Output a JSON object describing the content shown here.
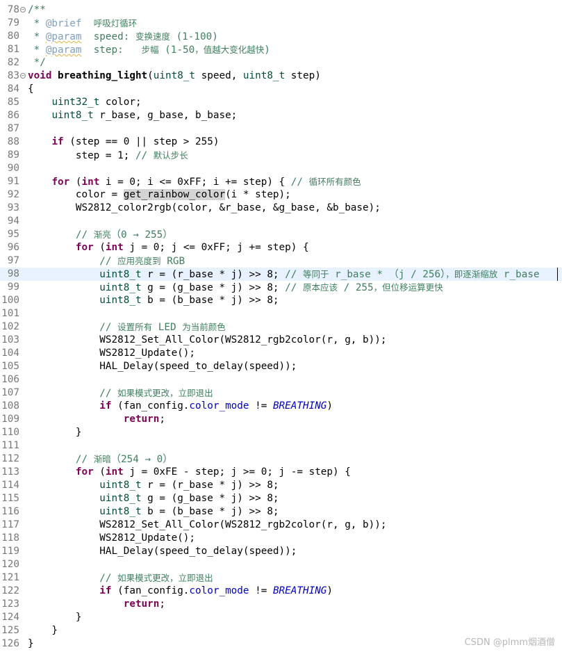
{
  "editor": {
    "first_line": 78,
    "current_line": 98,
    "lines": [
      {
        "n": "78",
        "fold": "−",
        "tokens": [
          [
            "c",
            "/**"
          ]
        ]
      },
      {
        "n": "79",
        "tokens": [
          [
            "c",
            " * "
          ],
          [
            "d",
            "@brief"
          ],
          [
            "c",
            "  "
          ],
          [
            "c cj",
            "呼吸灯循环"
          ]
        ]
      },
      {
        "n": "80",
        "tokens": [
          [
            "c",
            " * "
          ],
          [
            "d sq",
            "@param"
          ],
          [
            "c",
            "  speed: "
          ],
          [
            "c cj",
            "变换速度"
          ],
          [
            "c",
            " (1-100)"
          ]
        ]
      },
      {
        "n": "81",
        "tokens": [
          [
            "c",
            " * "
          ],
          [
            "d sq",
            "@param"
          ],
          [
            "c",
            "  step:   "
          ],
          [
            "c cj",
            "步幅"
          ],
          [
            "c",
            " (1-50"
          ],
          [
            "c cj",
            "，值越大变化越快"
          ],
          [
            "c",
            ")"
          ]
        ]
      },
      {
        "n": "82",
        "tokens": [
          [
            "c",
            " */"
          ]
        ]
      },
      {
        "n": "83",
        "fold": "−",
        "tokens": [
          [
            "k",
            "void"
          ],
          [
            "",
            " "
          ],
          [
            "b",
            "breathing_light"
          ],
          [
            "",
            "("
          ],
          [
            "t",
            "uint8_t"
          ],
          [
            "",
            " speed, "
          ],
          [
            "t",
            "uint8_t"
          ],
          [
            "",
            " step)"
          ]
        ]
      },
      {
        "n": "84",
        "tokens": [
          [
            "",
            "{"
          ]
        ]
      },
      {
        "n": "85",
        "tokens": [
          [
            "",
            "    "
          ],
          [
            "t",
            "uint32_t"
          ],
          [
            "",
            " color;"
          ]
        ]
      },
      {
        "n": "86",
        "tokens": [
          [
            "",
            "    "
          ],
          [
            "t",
            "uint8_t"
          ],
          [
            "",
            " r_base, g_base, b_base;"
          ]
        ]
      },
      {
        "n": "87",
        "tokens": []
      },
      {
        "n": "88",
        "tokens": [
          [
            "",
            "    "
          ],
          [
            "k",
            "if"
          ],
          [
            "",
            " (step == 0 || step > 255)"
          ]
        ]
      },
      {
        "n": "89",
        "tokens": [
          [
            "",
            "        step = 1; "
          ],
          [
            "c",
            "// "
          ],
          [
            "c cj",
            "默认步长"
          ]
        ]
      },
      {
        "n": "90",
        "tokens": []
      },
      {
        "n": "91",
        "tokens": [
          [
            "",
            "    "
          ],
          [
            "k",
            "for"
          ],
          [
            "",
            " ("
          ],
          [
            "k",
            "int"
          ],
          [
            "",
            " i = 0; i <= 0xFF; i += step) { "
          ],
          [
            "c",
            "// "
          ],
          [
            "c cj",
            "循环所有颜色"
          ]
        ]
      },
      {
        "n": "92",
        "tokens": [
          [
            "",
            "        color = "
          ],
          [
            "hl",
            "get_rainbow_color"
          ],
          [
            "",
            "(i * step);"
          ]
        ]
      },
      {
        "n": "93",
        "tokens": [
          [
            "",
            "        WS2812_color2rgb(color, &r_base, &g_base, &b_base);"
          ]
        ]
      },
      {
        "n": "94",
        "tokens": []
      },
      {
        "n": "95",
        "tokens": [
          [
            "",
            "        "
          ],
          [
            "c",
            "// "
          ],
          [
            "c cj",
            "渐亮"
          ],
          [
            "c",
            "（0 → 255）"
          ]
        ]
      },
      {
        "n": "96",
        "tokens": [
          [
            "",
            "        "
          ],
          [
            "k",
            "for"
          ],
          [
            "",
            " ("
          ],
          [
            "k",
            "int"
          ],
          [
            "",
            " j = 0; j <= 0xFF; j += step) {"
          ]
        ]
      },
      {
        "n": "97",
        "tokens": [
          [
            "",
            "            "
          ],
          [
            "c",
            "// "
          ],
          [
            "c cj",
            "应用亮度到"
          ],
          [
            "c",
            " RGB"
          ]
        ]
      },
      {
        "n": "98",
        "tokens": [
          [
            "",
            "            "
          ],
          [
            "t",
            "uint8_t"
          ],
          [
            "",
            " r = (r_base * j) >> 8; "
          ],
          [
            "c",
            "// "
          ],
          [
            "c cj",
            "等同于"
          ],
          [
            "c",
            " r_base * （j / 256）"
          ],
          [
            "c cj",
            "，即逐渐缩放"
          ],
          [
            "c",
            " r_base"
          ]
        ]
      },
      {
        "n": "99",
        "tokens": [
          [
            "",
            "            "
          ],
          [
            "t",
            "uint8_t"
          ],
          [
            "",
            " g = (g_base * j) >> 8; "
          ],
          [
            "c",
            "// "
          ],
          [
            "c cj",
            "原本应该"
          ],
          [
            "c",
            " / 255"
          ],
          [
            "c cj",
            "，但位移运算更快"
          ]
        ]
      },
      {
        "n": "100",
        "tokens": [
          [
            "",
            "            "
          ],
          [
            "t",
            "uint8_t"
          ],
          [
            "",
            " b = (b_base * j) >> 8;"
          ]
        ]
      },
      {
        "n": "101",
        "tokens": []
      },
      {
        "n": "102",
        "tokens": [
          [
            "",
            "            "
          ],
          [
            "c",
            "// "
          ],
          [
            "c cj",
            "设置所有"
          ],
          [
            "c",
            " LED "
          ],
          [
            "c cj",
            "为当前颜色"
          ]
        ]
      },
      {
        "n": "103",
        "tokens": [
          [
            "",
            "            WS2812_Set_All_Color(WS2812_rgb2color(r, g, b));"
          ]
        ]
      },
      {
        "n": "104",
        "tokens": [
          [
            "",
            "            WS2812_Update();"
          ]
        ]
      },
      {
        "n": "105",
        "tokens": [
          [
            "",
            "            HAL_Delay(speed_to_delay(speed));"
          ]
        ]
      },
      {
        "n": "106",
        "tokens": []
      },
      {
        "n": "107",
        "tokens": [
          [
            "",
            "            "
          ],
          [
            "c",
            "// "
          ],
          [
            "c cj",
            "如果模式更改，立即退出"
          ]
        ]
      },
      {
        "n": "108",
        "tokens": [
          [
            "",
            "            "
          ],
          [
            "k",
            "if"
          ],
          [
            "",
            " (fan_config."
          ],
          [
            "f",
            "color_mode"
          ],
          [
            "",
            " != "
          ],
          [
            "e",
            "BREATHING"
          ],
          [
            "",
            ")"
          ]
        ]
      },
      {
        "n": "109",
        "tokens": [
          [
            "",
            "                "
          ],
          [
            "k",
            "return"
          ],
          [
            "",
            ";"
          ]
        ]
      },
      {
        "n": "110",
        "tokens": [
          [
            "",
            "        }"
          ]
        ]
      },
      {
        "n": "111",
        "tokens": []
      },
      {
        "n": "112",
        "tokens": [
          [
            "",
            "        "
          ],
          [
            "c",
            "// "
          ],
          [
            "c cj",
            "渐暗"
          ],
          [
            "c",
            "（254 → 0）"
          ]
        ]
      },
      {
        "n": "113",
        "tokens": [
          [
            "",
            "        "
          ],
          [
            "k",
            "for"
          ],
          [
            "",
            " ("
          ],
          [
            "k",
            "int"
          ],
          [
            "",
            " j = 0xFE - step; j >= 0; j -= step) {"
          ]
        ]
      },
      {
        "n": "114",
        "tokens": [
          [
            "",
            "            "
          ],
          [
            "t",
            "uint8_t"
          ],
          [
            "",
            " r = (r_base * j) >> 8;"
          ]
        ]
      },
      {
        "n": "115",
        "tokens": [
          [
            "",
            "            "
          ],
          [
            "t",
            "uint8_t"
          ],
          [
            "",
            " g = (g_base * j) >> 8;"
          ]
        ]
      },
      {
        "n": "116",
        "tokens": [
          [
            "",
            "            "
          ],
          [
            "t",
            "uint8_t"
          ],
          [
            "",
            " b = (b_base * j) >> 8;"
          ]
        ]
      },
      {
        "n": "117",
        "tokens": [
          [
            "",
            "            WS2812_Set_All_Color(WS2812_rgb2color(r, g, b));"
          ]
        ]
      },
      {
        "n": "118",
        "tokens": [
          [
            "",
            "            WS2812_Update();"
          ]
        ]
      },
      {
        "n": "119",
        "tokens": [
          [
            "",
            "            HAL_Delay(speed_to_delay(speed));"
          ]
        ]
      },
      {
        "n": "120",
        "tokens": []
      },
      {
        "n": "121",
        "tokens": [
          [
            "",
            "            "
          ],
          [
            "c",
            "// "
          ],
          [
            "c cj",
            "如果模式更改，立即退出"
          ]
        ]
      },
      {
        "n": "122",
        "tokens": [
          [
            "",
            "            "
          ],
          [
            "k",
            "if"
          ],
          [
            "",
            " (fan_config."
          ],
          [
            "f",
            "color_mode"
          ],
          [
            "",
            " != "
          ],
          [
            "e",
            "BREATHING"
          ],
          [
            "",
            ")"
          ]
        ]
      },
      {
        "n": "123",
        "tokens": [
          [
            "",
            "                "
          ],
          [
            "k",
            "return"
          ],
          [
            "",
            ";"
          ]
        ]
      },
      {
        "n": "124",
        "tokens": [
          [
            "",
            "        }"
          ]
        ]
      },
      {
        "n": "125",
        "tokens": [
          [
            "",
            "    }"
          ]
        ]
      },
      {
        "n": "126",
        "tokens": [
          [
            "",
            "}"
          ]
        ]
      }
    ]
  },
  "watermark": "CSDN @plmm烟酒僧",
  "colors": {
    "keyword": "#7f0055",
    "type": "#005032",
    "comment": "#3f7f5f",
    "doc_tag": "#7f9fbf",
    "field": "#0000c0",
    "current_line_bg": "#e8f2fe"
  }
}
